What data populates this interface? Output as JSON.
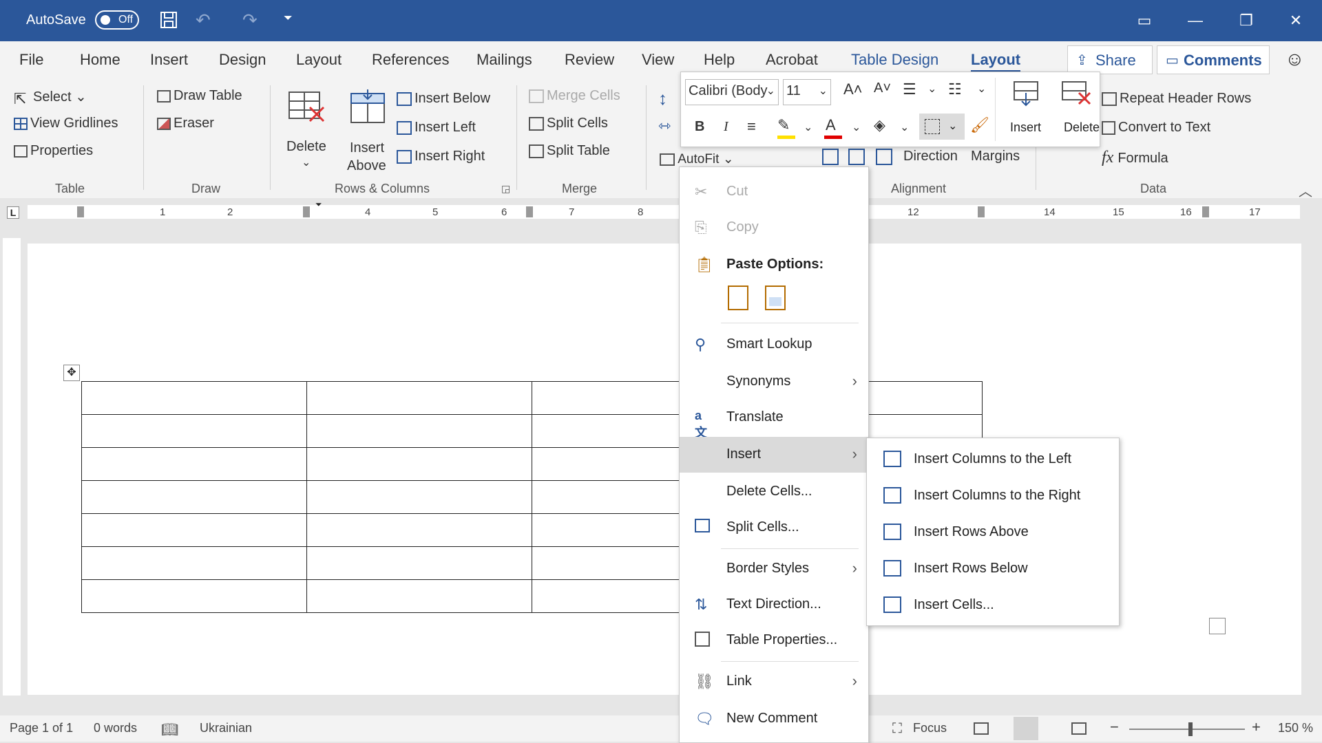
{
  "titlebar": {
    "autosave_label": "AutoSave",
    "autosave_state": "Off",
    "icons": [
      "save-icon",
      "undo-icon",
      "redo-icon",
      "customize-icon",
      "ribbon-display-icon",
      "minimize-icon",
      "restore-icon",
      "close-icon"
    ]
  },
  "tabs": [
    "File",
    "Home",
    "Insert",
    "Design",
    "Layout",
    "References",
    "Mailings",
    "Review",
    "View",
    "Help",
    "Acrobat",
    "Table Design",
    "Layout"
  ],
  "share_label": "Share",
  "comments_label": "Comments",
  "ribbon": {
    "table": {
      "select": "Select",
      "view_gridlines": "View Gridlines",
      "properties": "Properties",
      "group": "Table"
    },
    "draw": {
      "draw_table": "Draw Table",
      "eraser": "Eraser",
      "group": "Draw"
    },
    "rows_cols": {
      "delete": "Delete",
      "insert_above_1": "Insert",
      "insert_above_2": "Above",
      "insert_below": "Insert Below",
      "insert_left": "Insert Left",
      "insert_right": "Insert Right",
      "group": "Rows & Columns"
    },
    "merge": {
      "merge_cells": "Merge Cells",
      "split_cells": "Split Cells",
      "split_table": "Split Table",
      "group": "Merge"
    },
    "cell_size": {
      "autofit": "AutoFit"
    },
    "alignment": {
      "direction": "Direction",
      "margins": "Margins",
      "group": "Alignment"
    },
    "data": {
      "repeat_header": "Repeat Header Rows",
      "convert_text": "Convert to Text",
      "formula": "Formula",
      "group": "Data"
    }
  },
  "mini_toolbar": {
    "font_name": "Calibri (Body",
    "font_size": "11",
    "insert": "Insert",
    "delete": "Delete",
    "colors": {
      "highlight": "#ffe000",
      "font": "#e00000"
    }
  },
  "ruler_numbers": [
    "1",
    "2",
    "4",
    "5",
    "6",
    "7",
    "8",
    "12",
    "14",
    "15",
    "16",
    "17"
  ],
  "context_menu": {
    "cut": "Cut",
    "copy": "Copy",
    "paste_options": "Paste Options:",
    "smart_lookup": "Smart Lookup",
    "synonyms": "Synonyms",
    "translate": "Translate",
    "insert": "Insert",
    "delete_cells": "Delete Cells...",
    "split_cells": "Split Cells...",
    "border_styles": "Border Styles",
    "text_direction": "Text Direction...",
    "table_properties": "Table Properties...",
    "link": "Link",
    "new_comment": "New Comment"
  },
  "submenu": {
    "cols_left": "Insert Columns to the Left",
    "cols_right": "Insert Columns to the Right",
    "rows_above": "Insert Rows Above",
    "rows_below": "Insert Rows Below",
    "cells": "Insert Cells..."
  },
  "status": {
    "page": "Page 1 of 1",
    "words": "0 words",
    "language": "Ukrainian",
    "focus": "Focus",
    "zoom": "150 %"
  },
  "table": {
    "rows": 7,
    "cols": 4
  }
}
